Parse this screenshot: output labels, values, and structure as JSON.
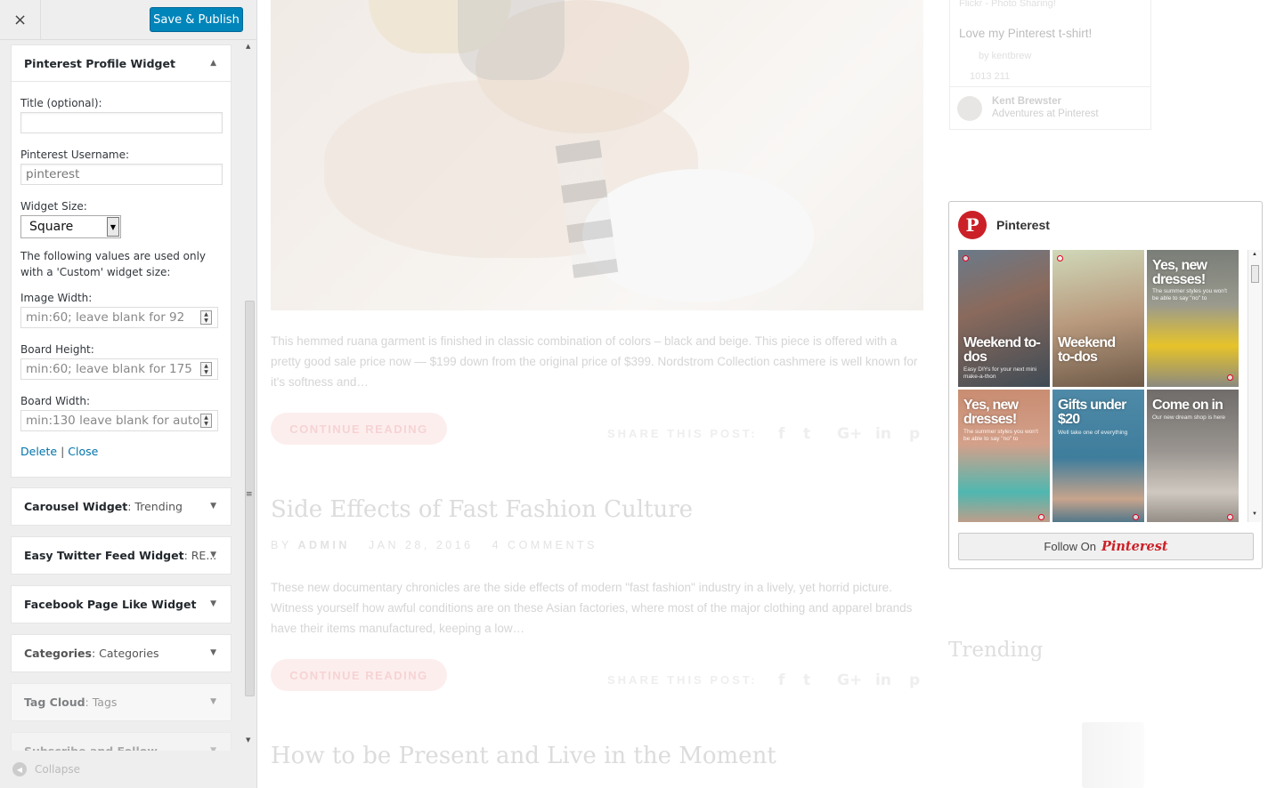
{
  "sidebar": {
    "close_icon": "×",
    "save_label": "Save & Publish",
    "active_widget": {
      "title": "Pinterest Profile Widget",
      "fields": {
        "title_label": "Title (optional):",
        "title_value": "",
        "username_label": "Pinterest Username:",
        "username_value": "pinterest",
        "size_label": "Widget Size:",
        "size_value": "Square",
        "note": "The following values are used only with a 'Custom' widget size:",
        "image_width_label": "Image Width:",
        "image_width_placeholder": "min:60; leave blank for 92",
        "board_height_label": "Board Height:",
        "board_height_placeholder": "min:60; leave blank for 175",
        "board_width_label": "Board Width:",
        "board_width_placeholder": "min:130 leave blank for auto"
      },
      "delete_label": "Delete",
      "separator": "|",
      "close_label": "Close"
    },
    "widgets": [
      {
        "name": "Carousel Widget",
        "sub": ": Trending"
      },
      {
        "name": "Easy Twitter Feed Widget",
        "sub": ": RE..."
      },
      {
        "name": "Facebook Page Like Widget",
        "sub": ""
      },
      {
        "name": "Categories",
        "sub": ": Categories"
      },
      {
        "name": "Tag Cloud",
        "sub": ": Tags"
      },
      {
        "name": "Subscribe and Follow",
        "sub": ""
      }
    ],
    "collapse_label": "Collapse"
  },
  "preview": {
    "post1": {
      "excerpt": "This hemmed ruana garment is finished in classic combination of colors – black and beige. This piece is offered with a pretty good sale price now — $199 down from the original price of $399.  Nordstrom Collection cashmere is well known for it's softness and…",
      "continue_label": "CONTINUE READING",
      "share_label": "SHARE THIS POST:"
    },
    "post2": {
      "title": "Side Effects of Fast Fashion Culture",
      "meta_by": "BY",
      "meta_author": "ADMIN",
      "meta_date": "JAN 28, 2016",
      "meta_comments": "4 COMMENTS",
      "excerpt": "These new documentary chronicles are the side effects of modern \"fast fashion\" industry in a lively, yet horrid picture. Witness yourself how awful conditions are on these Asian factories, where most of the major clothing and apparel brands have their items manufactured, keeping a low…",
      "continue_label": "CONTINUE READING",
      "share_label": "SHARE THIS POST:"
    },
    "post3": {
      "title": "How to be Present and Live in the Moment"
    },
    "social_icons": [
      "f",
      "t",
      "G+",
      "in",
      "p"
    ],
    "top_widget": {
      "source": "Flickr - Photo Sharing!",
      "description": "Love my Pinterest t-shirt!",
      "by": "by kentbrew",
      "stats": "1013   211",
      "author": "Kent Brewster",
      "board": "Adventures at Pinterest"
    },
    "pinterest_widget": {
      "logo_letter": "P",
      "title": "Pinterest",
      "pins": [
        {
          "headline": "Weekend to-dos",
          "sub": "Easy DIYs for your next mini make-a-thon"
        },
        {
          "headline": "Weekend to-dos",
          "sub": ""
        },
        {
          "headline": "Yes, new dresses!",
          "sub": "The summer styles you won't be able to say \"no\" to"
        },
        {
          "headline": "Yes, new dresses!",
          "sub": "The summer styles you won't be able to say \"no\" to"
        },
        {
          "headline": "Gifts under $20",
          "sub": "Well take one of everything"
        },
        {
          "headline": "Come on in",
          "sub": "Our new dream shop is here"
        }
      ],
      "follow_label": "Follow On",
      "follow_brand": "Pinterest"
    },
    "trending_label": "Trending"
  },
  "colors": {
    "publish": "#0085ba",
    "link": "#0073aa",
    "pinterest_red": "#cb2027"
  }
}
